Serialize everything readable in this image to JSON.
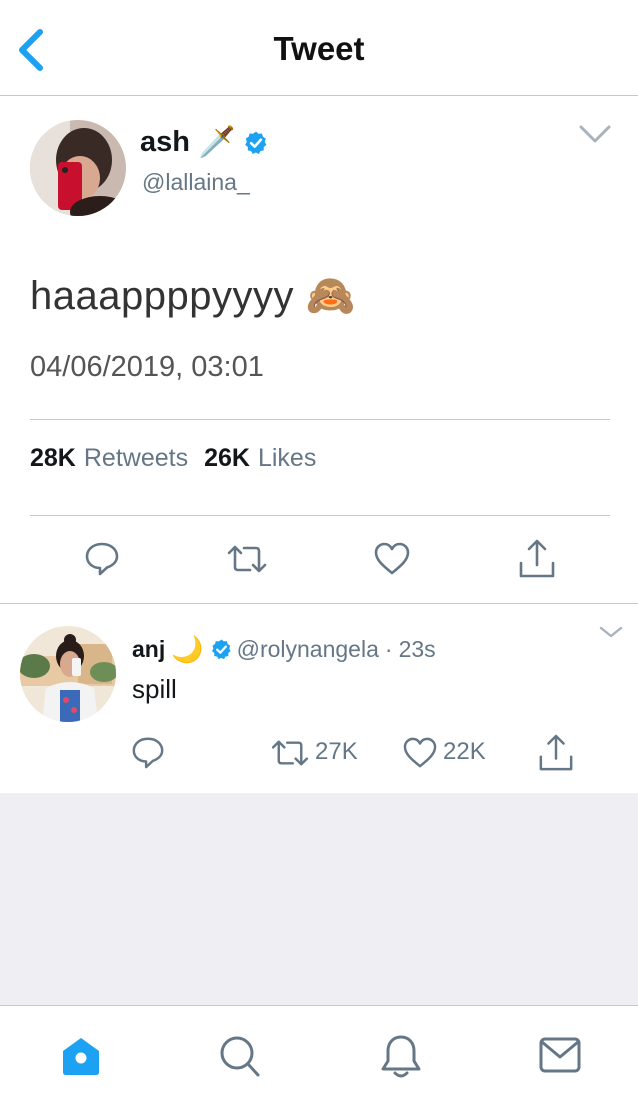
{
  "header": {
    "title": "Tweet"
  },
  "tweet": {
    "author_name": "ash",
    "author_emoji": "🗡️",
    "handle": "@lallaina_",
    "text": "haaappppyyyy 🙈",
    "timestamp": "04/06/2019, 03:01",
    "retweets_count": "28K",
    "retweets_label": "Retweets",
    "likes_count": "26K",
    "likes_label": "Likes"
  },
  "reply": {
    "author_name": "anj",
    "author_emoji": "🌙",
    "handle": "@rolynangela",
    "separator": "·",
    "time": "23s",
    "text": "spill",
    "retweet_count": "27K",
    "like_count": "22K"
  },
  "tabs": [
    "home-icon",
    "search-icon",
    "notifications-icon",
    "messages-icon"
  ],
  "colors": {
    "accent": "#1da1f2",
    "muted": "#657786",
    "verified": "#1da1f2",
    "empty_background": "#eeeef3"
  }
}
